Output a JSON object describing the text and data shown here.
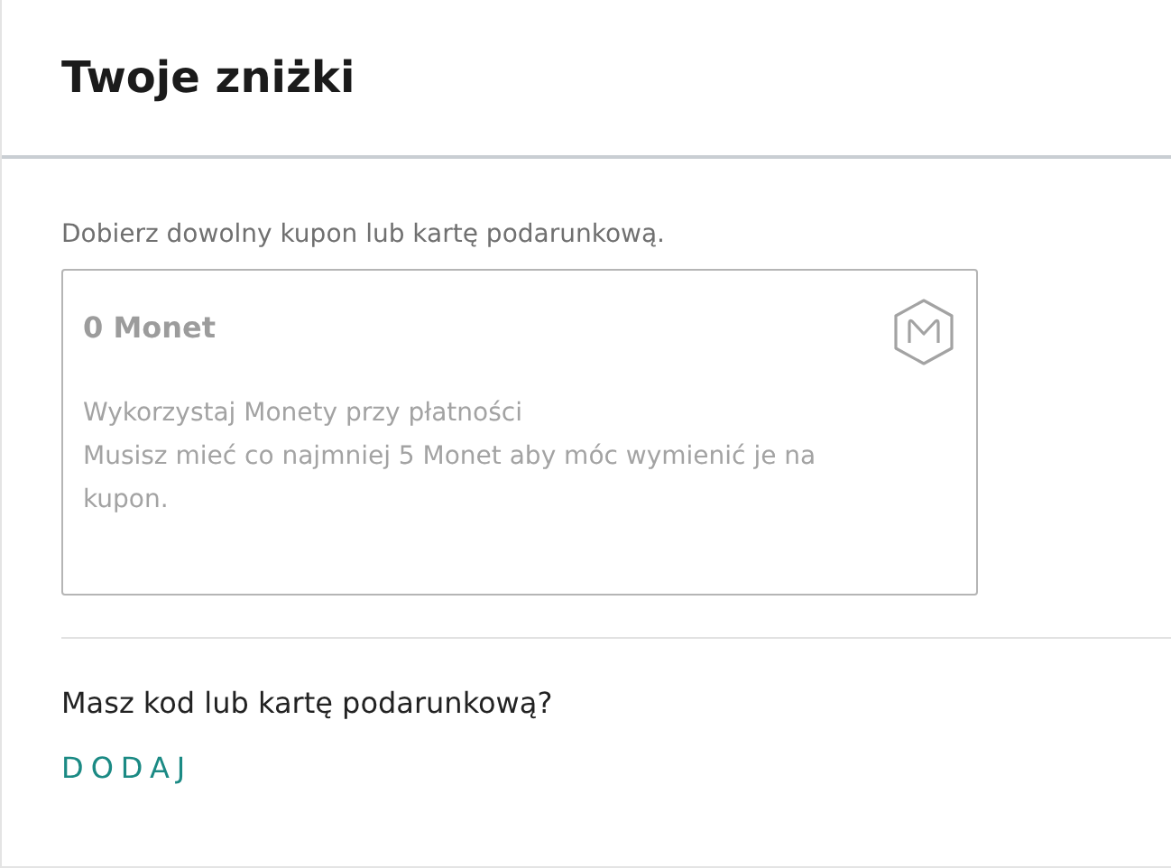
{
  "header": {
    "title": "Twoje zniżki"
  },
  "intro": "Dobierz dowolny kupon lub kartę podarunkową.",
  "coins_card": {
    "title": "0 Monet",
    "disabled": true,
    "lines": [
      "Wykorzystaj Monety przy płatności",
      "Musisz mieć co najmniej 5 Monet aby móc wymienić je na kupon."
    ]
  },
  "code_section": {
    "question": "Masz kod lub kartę podarunkową?",
    "action": "DODAJ"
  }
}
